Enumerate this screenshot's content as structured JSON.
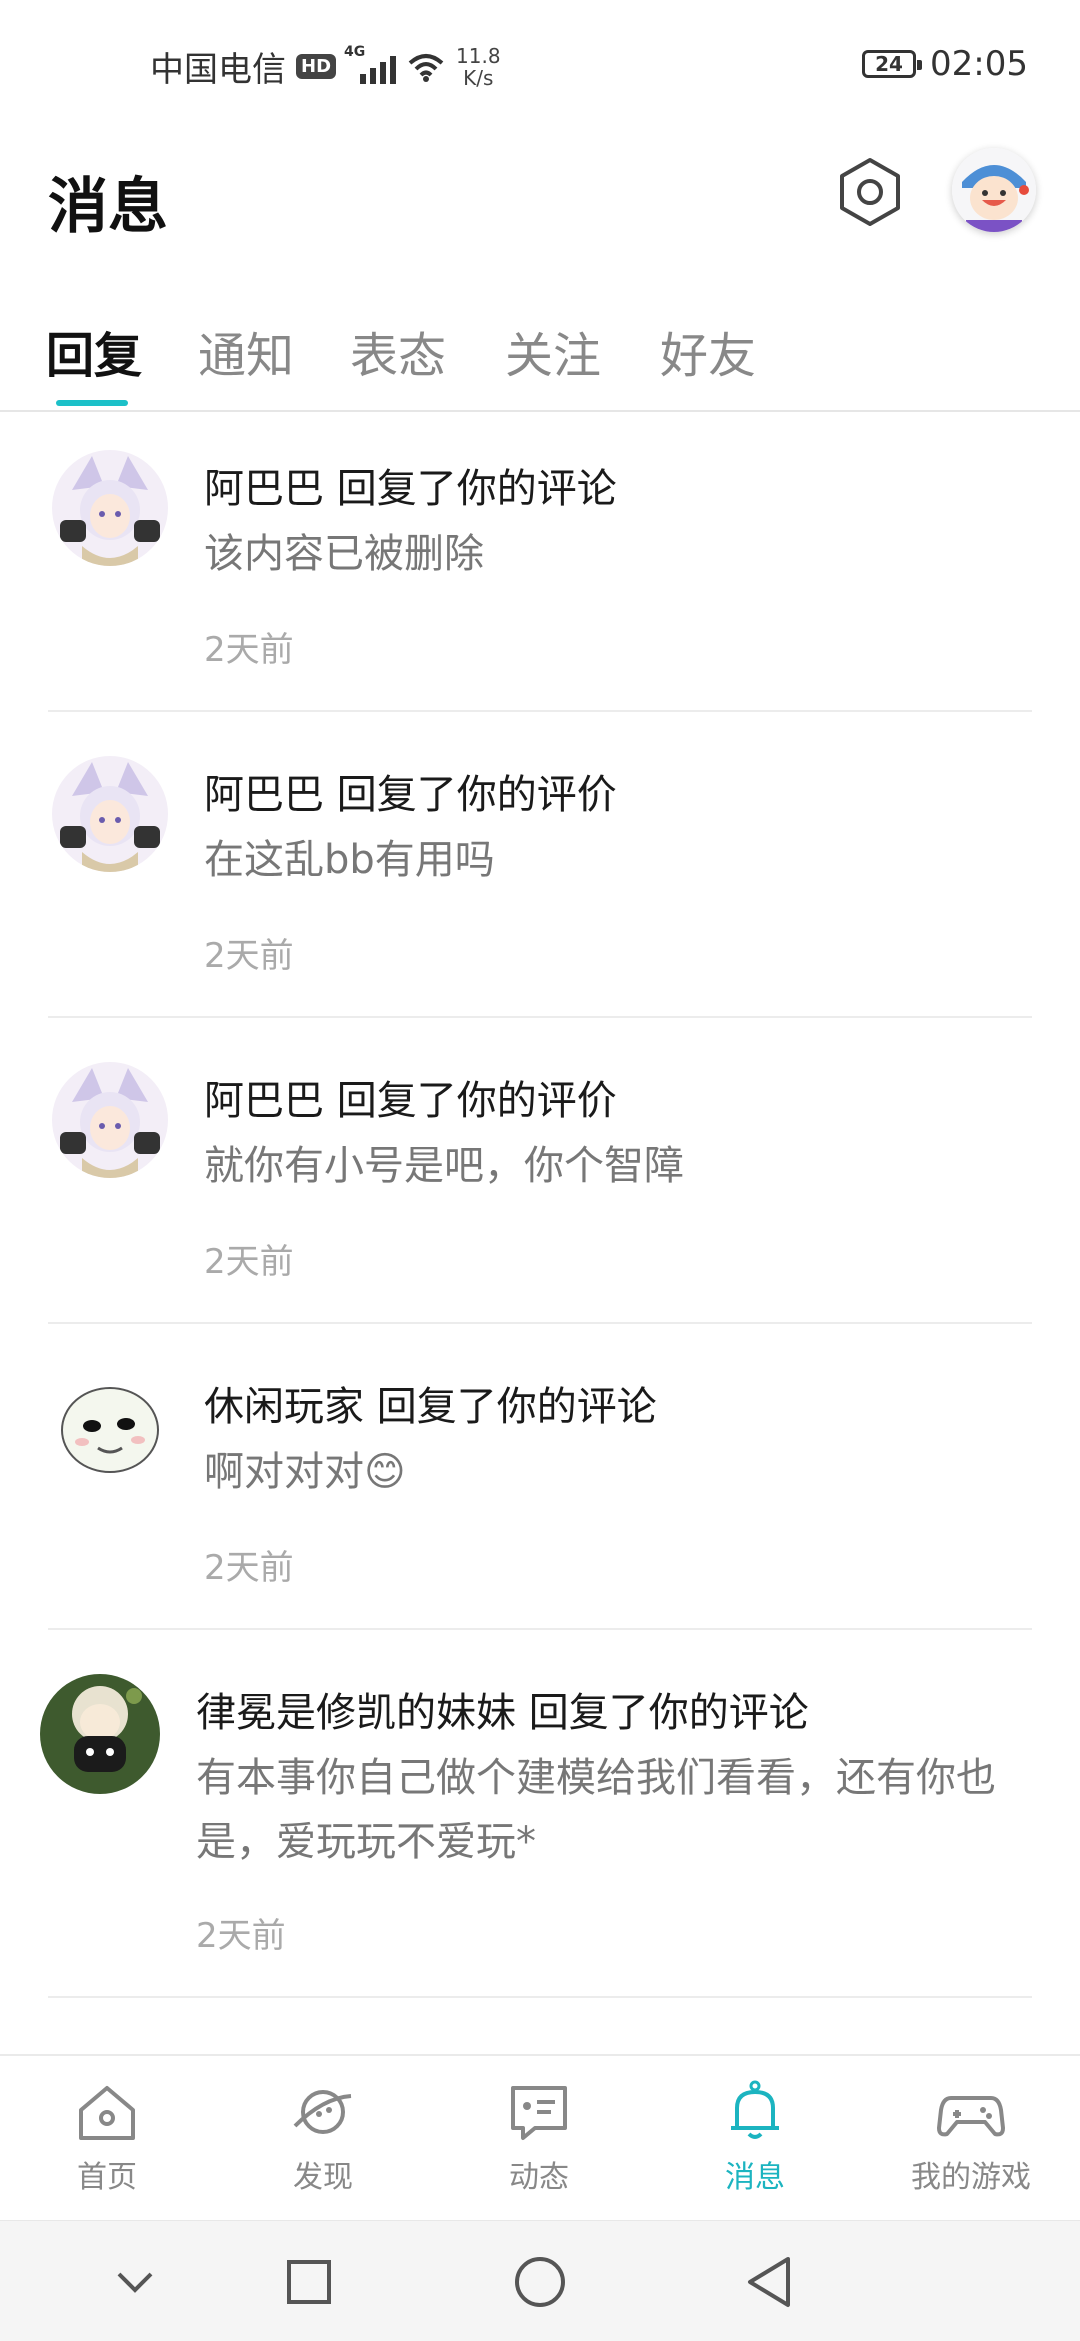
{
  "status_bar": {
    "carrier": "中国电信",
    "hd": "HD",
    "network": "4G",
    "speed_value": "11.8",
    "speed_unit": "K/s",
    "battery": "24",
    "time": "02:05"
  },
  "header": {
    "title": "消息"
  },
  "tabs": [
    {
      "label": "回复",
      "active": true
    },
    {
      "label": "通知",
      "active": false
    },
    {
      "label": "表态",
      "active": false
    },
    {
      "label": "关注",
      "active": false
    },
    {
      "label": "好友",
      "active": false
    }
  ],
  "messages": [
    {
      "name_line": "阿巴巴 回复了你的评论",
      "body": "该内容已被删除",
      "time": "2天前"
    },
    {
      "name_line": "阿巴巴 回复了你的评价",
      "body": "在这乱bb有用吗",
      "time": "2天前"
    },
    {
      "name_line": "阿巴巴 回复了你的评价",
      "body": "就你有小号是吧，你个智障",
      "time": "2天前"
    },
    {
      "name_line": "休闲玩家 回复了你的评论",
      "body": "啊对对对😊",
      "time": "2天前"
    },
    {
      "name_line": "律冕是修凯的妹妹 回复了你的评论",
      "body": "有本事你自己做个建模给我们看看，还有你也是，爱玩玩不爱玩*",
      "time": "2天前"
    }
  ],
  "bottom_nav": [
    {
      "label": "首页",
      "icon": "home-icon",
      "active": false
    },
    {
      "label": "发现",
      "icon": "planet-icon",
      "active": false
    },
    {
      "label": "动态",
      "icon": "chat-card-icon",
      "active": false
    },
    {
      "label": "消息",
      "icon": "bell-icon",
      "active": true
    },
    {
      "label": "我的游戏",
      "icon": "gamepad-icon",
      "active": false
    }
  ],
  "colors": {
    "accent": "#1cc0c8",
    "active_nav": "#1cb4c0",
    "muted_text": "#777777",
    "time_text": "#aaaaaa"
  }
}
